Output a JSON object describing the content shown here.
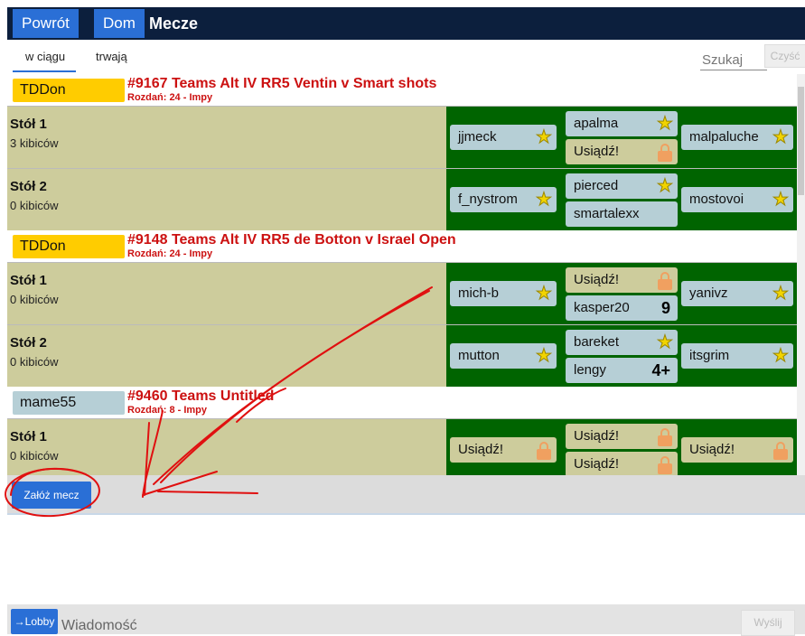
{
  "topbar": {
    "back": "Powrót",
    "home": "Dom",
    "title": "Mecze"
  },
  "tabs": [
    "w ciągu",
    "trwają"
  ],
  "search": {
    "placeholder": "Szukaj",
    "clear": "Czyść"
  },
  "matches": [
    {
      "director": "TDDon",
      "title": "#9167 Teams Alt IV RR5 Ventin v Smart shots",
      "subtitle": "Rozdań: 24 - Impy",
      "tables": [
        {
          "name": "Stół 1",
          "kibitzers": "3 kibiców",
          "seats": {
            "west": "jjmeck",
            "north": "apalma",
            "south": "Usiądź!",
            "east": "malpaluche"
          }
        },
        {
          "name": "Stół 2",
          "kibitzers": "0 kibiców",
          "seats": {
            "west": "f_nystrom",
            "north": "pierced",
            "south": "smartalexx",
            "east": "mostovoi"
          }
        }
      ]
    },
    {
      "director": "TDDon",
      "title": "#9148 Teams Alt IV RR5 de Botton v Israel Open",
      "subtitle": "Rozdań: 24 - Impy",
      "tables": [
        {
          "name": "Stół 1",
          "kibitzers": "0 kibiców",
          "seats": {
            "west": "mich-b",
            "north": "Usiądź!",
            "south": "kasper20",
            "south_count": "9",
            "east": "yanivz"
          }
        },
        {
          "name": "Stół 2",
          "kibitzers": "0 kibiców",
          "seats": {
            "west": "mutton",
            "north": "bareket",
            "south": "lengy",
            "south_count": "4+",
            "east": "itsgrim"
          }
        }
      ]
    },
    {
      "director": "mame55",
      "title": "#9460 Teams Untitled",
      "subtitle": "Rozdań: 8 - Impy",
      "tables": [
        {
          "name": "Stół 1",
          "kibitzers": "0 kibiców",
          "seats": {
            "west": "Usiądź!",
            "north": "Usiądź!",
            "south": "Usiądź!",
            "east": "Usiądź!"
          }
        }
      ]
    }
  ],
  "create_match": "Załóż mecz",
  "bottom": {
    "lobby": "→Lobby",
    "message_placeholder": "Wiadomość",
    "send": "Wyślij"
  },
  "colors": {
    "topbar": "#0c1f3d",
    "button_blue": "#2a6fd6",
    "title_red": "#cc1111",
    "seat_area": "#006400",
    "table_bg": "#cdcc9c",
    "director_yellow": "#ffcc00"
  },
  "icons": [
    "star-icon",
    "lock-icon"
  ]
}
